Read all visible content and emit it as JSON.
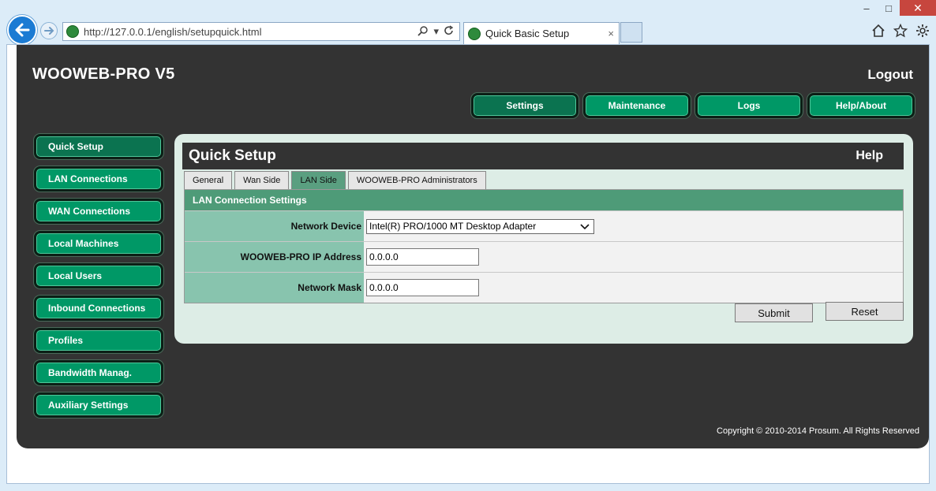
{
  "browser": {
    "url": "http://127.0.0.1/english/setupquick.html",
    "tab_title": "Quick Basic Setup",
    "tab_close": "×",
    "window_minimize": "–",
    "window_maximize": "□",
    "window_close": "✕",
    "icons": [
      "back-arrow-icon",
      "forward-arrow-icon",
      "search-icon",
      "refresh-icon",
      "home-icon",
      "favorites-star-icon",
      "gear-icon"
    ]
  },
  "app": {
    "brand": "WOOWEB-PRO V5",
    "logout": "Logout",
    "copyright": "Copyright © 2010-2014 Prosum. All Rights Reserved"
  },
  "topnav": [
    {
      "label": "Settings",
      "active": true
    },
    {
      "label": "Maintenance",
      "active": false
    },
    {
      "label": "Logs",
      "active": false
    },
    {
      "label": "Help/About",
      "active": false
    }
  ],
  "sidenav": [
    {
      "label": "Quick Setup",
      "active": true
    },
    {
      "label": "LAN Connections"
    },
    {
      "label": "WAN Connections"
    },
    {
      "label": "Local Machines"
    },
    {
      "label": "Local Users"
    },
    {
      "label": "Inbound Connections"
    },
    {
      "label": "Profiles"
    },
    {
      "label": "Bandwidth Manag."
    },
    {
      "label": "Auxiliary Settings"
    }
  ],
  "content": {
    "title": "Quick Setup",
    "help": "Help",
    "tabs": [
      {
        "label": "General"
      },
      {
        "label": "Wan Side"
      },
      {
        "label": "LAN Side",
        "active": true
      },
      {
        "label": "WOOWEB-PRO Administrators"
      }
    ],
    "section_title": "LAN Connection Settings",
    "fields": {
      "network_device_label": "Network Device",
      "network_device_value": "Intel(R) PRO/1000 MT Desktop Adapter",
      "ip_label": "WOOWEB-PRO IP Address",
      "ip_value": "0.0.0.0",
      "mask_label": "Network Mask",
      "mask_value": "0.0.0.0"
    },
    "submit": "Submit",
    "reset": "Reset"
  },
  "colors": {
    "button_green": "#009866",
    "button_green_active": "#0b7350",
    "frame_dark": "#333333",
    "panel_bg": "#ddede6",
    "section_head": "#4e9b78",
    "label_bg": "#88c4ae"
  }
}
